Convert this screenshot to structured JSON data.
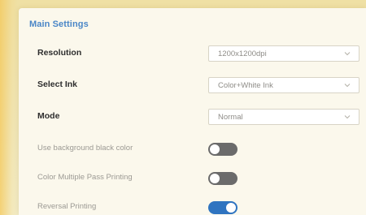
{
  "main_settings": {
    "title": "Main Settings",
    "resolution": {
      "label": "Resolution",
      "value": "1200x1200dpi"
    },
    "select_ink": {
      "label": "Select Ink",
      "value": "Color+White Ink"
    },
    "mode": {
      "label": "Mode",
      "value": "Normal"
    },
    "toggles": [
      {
        "label": "Use background black color",
        "state": "off"
      },
      {
        "label": "Color Multiple Pass Printing",
        "state": "off"
      },
      {
        "label": "Reversal Printing",
        "state": "on"
      }
    ]
  },
  "colors": {
    "accent": "#2f74c0",
    "title": "#4a86c7",
    "toggle_off": "#6b6b6b",
    "background": "#efe3a8"
  },
  "icons": {
    "dropdown": "chevron-down-icon"
  }
}
